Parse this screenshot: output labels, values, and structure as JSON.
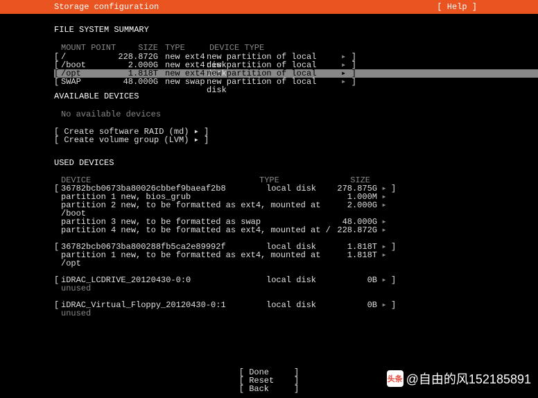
{
  "header": {
    "title": "Storage configuration",
    "help": "[ Help ]"
  },
  "fs_summary": {
    "title": "FILE SYSTEM SUMMARY",
    "headers": {
      "mount": "MOUNT POINT",
      "size": "SIZE",
      "type": "TYPE",
      "device_type": "DEVICE TYPE"
    },
    "rows": [
      {
        "mount": "/",
        "size": "228.872G",
        "type": "new ext4",
        "device_type": "new partition of local disk",
        "selected": false
      },
      {
        "mount": "/boot",
        "size": "2.000G",
        "type": "new ext4",
        "device_type": "new partition of local disk",
        "selected": false
      },
      {
        "mount": "/opt",
        "size": "1.818T",
        "type": "new ext4",
        "device_type": "new partition of local disk",
        "selected": true
      },
      {
        "mount": "SWAP",
        "size": "48.000G",
        "type": "new swap",
        "device_type": "new partition of local disk",
        "selected": false
      }
    ]
  },
  "available": {
    "title": "AVAILABLE DEVICES",
    "empty": "No available devices",
    "actions": {
      "raid": "Create software RAID (md) ▸",
      "lvm": "Create volume group (LVM) ▸"
    }
  },
  "used": {
    "title": "USED DEVICES",
    "headers": {
      "device": "DEVICE",
      "type": "TYPE",
      "size": "SIZE"
    },
    "devices": [
      {
        "name": "36782bcb0673ba80026cbbef9baeaf2b8",
        "type": "local disk",
        "size": "278.875G",
        "partitions": [
          {
            "desc": "partition 1  new, bios_grub",
            "size": "1.000M"
          },
          {
            "desc": "partition 2  new, to be formatted as ext4, mounted at /boot",
            "size": "2.000G"
          },
          {
            "desc": "partition 3  new, to be formatted as swap",
            "size": "48.000G"
          },
          {
            "desc": "partition 4  new, to be formatted as ext4, mounted at /",
            "size": "228.872G"
          }
        ],
        "unused": false
      },
      {
        "name": "36782bcb0673ba800288fb5ca2e89992f",
        "type": "local disk",
        "size": "1.818T",
        "partitions": [
          {
            "desc": "partition 1  new, to be formatted as ext4, mounted at /opt",
            "size": "1.818T"
          }
        ],
        "unused": false
      },
      {
        "name": "iDRAC_LCDRIVE_20120430-0:0",
        "type": "local disk",
        "size": "0B",
        "partitions": [],
        "unused": true
      },
      {
        "name": "iDRAC_Virtual_Floppy_20120430-0:1",
        "type": "local disk",
        "size": "0B",
        "partitions": [],
        "unused": true
      }
    ],
    "unused_label": "unused"
  },
  "buttons": {
    "done": "Done",
    "reset": "Reset",
    "back": "Back"
  },
  "watermark": {
    "icon": "头条",
    "text": "@自由的风152185891"
  },
  "glyphs": {
    "arrow": "▸",
    "bl": "[",
    "br": "]"
  }
}
